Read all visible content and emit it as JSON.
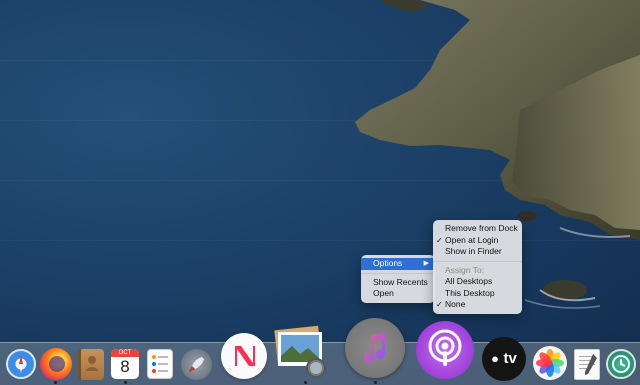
{
  "options_menu": {
    "items": [
      {
        "label": "Options",
        "selected": true,
        "submenu_arrow": "▶"
      },
      {
        "separator": true
      },
      {
        "label": "Show Recents"
      },
      {
        "label": "Open"
      }
    ]
  },
  "submenu": {
    "items": [
      {
        "label": "Remove from Dock",
        "checked": false
      },
      {
        "label": "Open at Login",
        "checked": true
      },
      {
        "label": "Show in Finder",
        "checked": false
      },
      {
        "separator": true
      },
      {
        "label": "Assign To:",
        "disabled": true
      },
      {
        "label": "All Desktops",
        "checked": false
      },
      {
        "label": "This Desktop",
        "checked": false
      },
      {
        "label": "None",
        "checked": true
      }
    ]
  },
  "dock": {
    "apps": [
      {
        "name": "Safari",
        "icon": "compass-icon"
      },
      {
        "name": "Firefox",
        "icon": "firefox-icon"
      },
      {
        "name": "Contacts",
        "icon": "contacts-icon"
      },
      {
        "name": "Calendar",
        "icon": "calendar-icon",
        "month": "OCT",
        "day": "8"
      },
      {
        "name": "Reminders",
        "icon": "reminders-icon"
      },
      {
        "name": "Launchpad",
        "icon": "rocket-icon"
      },
      {
        "name": "News",
        "icon": "news-icon"
      },
      {
        "name": "Preview",
        "icon": "preview-icon"
      },
      {
        "name": "Music",
        "icon": "music-note-icon"
      },
      {
        "name": "Podcasts",
        "icon": "podcast-icon"
      },
      {
        "name": "TV",
        "icon": "tv-icon",
        "label": "tv"
      },
      {
        "name": "Photos",
        "icon": "photos-flower-icon"
      },
      {
        "name": "TextEdit",
        "icon": "textedit-icon"
      },
      {
        "name": "Time Machine",
        "icon": "time-machine-icon"
      }
    ]
  },
  "colors": {
    "accent": "#2f6fd6",
    "sea": "#1c4168",
    "rock": "#6b6a52"
  }
}
